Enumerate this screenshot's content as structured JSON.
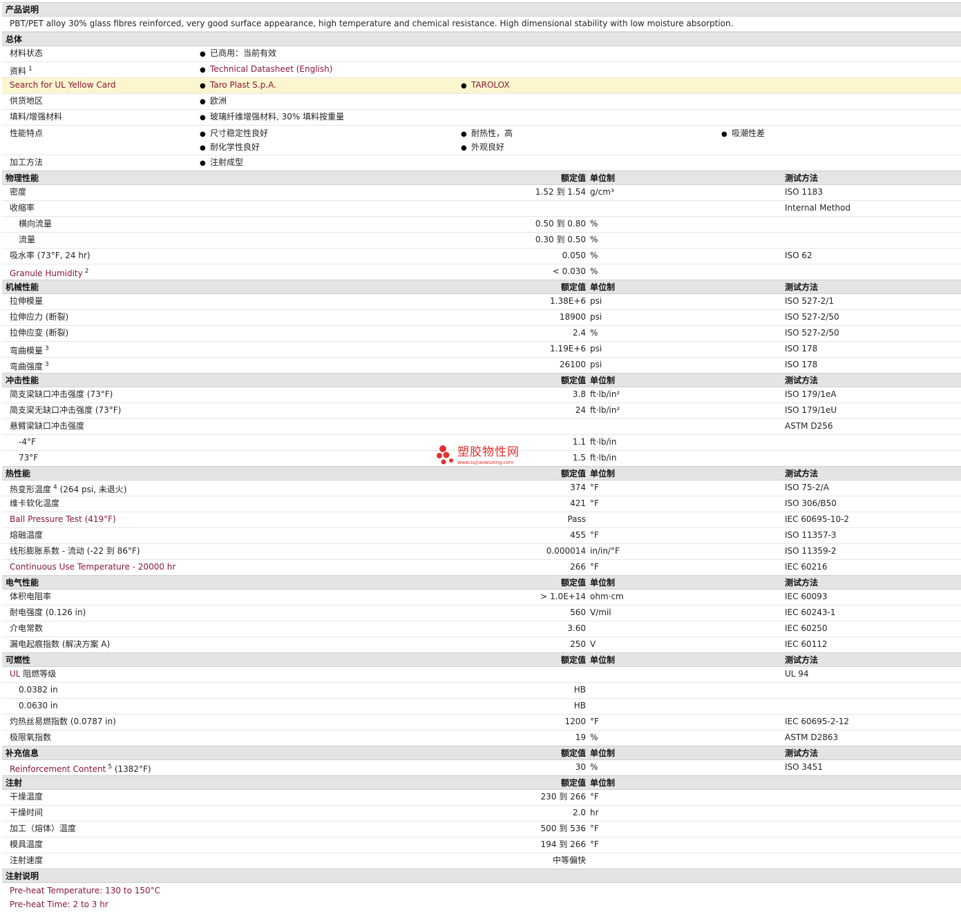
{
  "sections": {
    "product_desc": "产品说明",
    "general": "总体",
    "physical": "物理性能",
    "mechanical": "机械性能",
    "impact": "冲击性能",
    "thermal": "热性能",
    "electrical": "电气性能",
    "flammability": "可燃性",
    "additional": "补充信息",
    "injection": "注射",
    "injection_notes": "注射说明"
  },
  "col_headers": {
    "value": "额定值",
    "unit": "单位制",
    "test": "测试方法"
  },
  "description": "PBT/PET alloy 30% glass fibres reinforced, very good surface appearance, high temperature and chemical resistance. High dimensional stability with low moisture absorption.",
  "general": {
    "status_label": "材料状态",
    "status_value": "已商用：当前有效",
    "docs_label": "资料",
    "docs_sup": "1",
    "docs_link": "Technical Datasheet (English)",
    "ul_label": "Search for UL Yellow Card",
    "ul_link1": "Taro Plast S.p.A.",
    "ul_link2": "TAROLOX",
    "region_label": "供货地区",
    "region_value": "欧洲",
    "filler_label": "填料/增强材料",
    "filler_value": "玻璃纤维增强材料, 30% 填料按重量",
    "features_label": "性能特点",
    "features": [
      "尺寸稳定性良好",
      "耐热性，高",
      "吸潮性差",
      "耐化学性良好",
      "外观良好"
    ],
    "method_label": "加工方法",
    "method_value": "注射成型"
  },
  "physical": {
    "density": {
      "label": "密度",
      "value": "1.52 到  1.54",
      "unit": "g/cm³",
      "test": "ISO 1183"
    },
    "shrink": {
      "label": "收缩率",
      "test": "Internal Method"
    },
    "shrink_trans": {
      "label": "横向流量",
      "value": "0.50 到  0.80",
      "unit": "%"
    },
    "shrink_flow": {
      "label": "流量",
      "value": "0.30 到  0.50",
      "unit": "%"
    },
    "water": {
      "label": "吸水率  (73°F, 24 hr)",
      "value": "0.050",
      "unit": "%",
      "test": "ISO 62"
    },
    "granule": {
      "label": "Granule Humidity",
      "sup": "2",
      "value": "< 0.030",
      "unit": "%"
    }
  },
  "mechanical": {
    "tmod": {
      "label": "拉伸模量",
      "value": "1.38E+6",
      "unit": "psi",
      "test": "ISO 527-2/1"
    },
    "tstress": {
      "label": "拉伸应力  (断裂)",
      "value": "18900",
      "unit": "psi",
      "test": "ISO 527-2/50"
    },
    "tstrain": {
      "label": "拉伸应变  (断裂)",
      "value": "2.4",
      "unit": "%",
      "test": "ISO 527-2/50"
    },
    "fmod": {
      "label": "弯曲模量",
      "sup": "3",
      "value": "1.19E+6",
      "unit": "psi",
      "test": "ISO 178"
    },
    "fstr": {
      "label": "弯曲强度",
      "sup": "3",
      "value": "26100",
      "unit": "psi",
      "test": "ISO 178"
    }
  },
  "impact": {
    "charpy_n": {
      "label": "简支梁缺口冲击强度  (73°F)",
      "value": "3.8",
      "unit": "ft·lb/in²",
      "test": "ISO 179/1eA"
    },
    "charpy_u": {
      "label": "简支梁无缺口冲击强度  (73°F)",
      "value": "24",
      "unit": "ft·lb/in²",
      "test": "ISO 179/1eU"
    },
    "izod": {
      "label": "悬臂梁缺口冲击强度",
      "test": "ASTM D256"
    },
    "izod_m4": {
      "label": "-4°F",
      "value": "1.1",
      "unit": "ft·lb/in"
    },
    "izod_73": {
      "label": "73°F",
      "value": "1.5",
      "unit": "ft·lb/in"
    }
  },
  "thermal": {
    "hdt": {
      "label": "热变形温度",
      "sup": "4",
      "label2": "(264 psi, 未退火)",
      "value": "374",
      "unit": "°F",
      "test": "ISO 75-2/A"
    },
    "vicat": {
      "label": "维卡软化温度",
      "value": "421",
      "unit": "°F",
      "test": "ISO 306/B50"
    },
    "ball": {
      "label": "Ball Pressure Test  (419°F)",
      "value": "Pass",
      "test": "IEC 60695-10-2"
    },
    "melt": {
      "label": "熔融温度",
      "value": "455",
      "unit": "°F",
      "test": "ISO 11357-3"
    },
    "clte": {
      "label": "线形膨胀系数  - 流动  (-22 到  86°F)",
      "value": "0.000014",
      "unit": "in/in/°F",
      "test": "ISO 11359-2"
    },
    "cut": {
      "label": "Continuous Use Temperature - 20000 hr",
      "value": "266",
      "unit": "°F",
      "test": "IEC 60216"
    }
  },
  "electrical": {
    "vol": {
      "label": "体积电阻率",
      "value": "> 1.0E+14",
      "unit": "ohm·cm",
      "test": "IEC 60093"
    },
    "diel": {
      "label": "耐电强度  (0.126 in)",
      "value": "560",
      "unit": "V/mil",
      "test": "IEC 60243-1"
    },
    "const": {
      "label": "介电常数",
      "value": "3.60",
      "test": "IEC 60250"
    },
    "cti": {
      "label": "漏电起痕指数  (解决方案  A)",
      "value": "250",
      "unit": "V",
      "test": "IEC 60112"
    }
  },
  "flammability": {
    "ul": {
      "label_link": "UL",
      "label": " 阻燃等级",
      "test": "UL 94"
    },
    "ul_1": {
      "label": "0.0382 in",
      "value": "HB"
    },
    "ul_2": {
      "label": "0.0630 in",
      "value": "HB"
    },
    "gwfi": {
      "label": "灼热丝易燃指数  (0.0787 in)",
      "value": "1200",
      "unit": "°F",
      "test": "IEC 60695-2-12"
    },
    "loi": {
      "label": "极限氧指数",
      "value": "19",
      "unit": "%",
      "test": "ASTM D2863"
    }
  },
  "additional": {
    "reinf": {
      "label": "Reinforcement Content",
      "sup": "5",
      "label2": "(1382°F)",
      "value": "30",
      "unit": "%",
      "test": "ISO 3451"
    }
  },
  "injection": {
    "dry_temp": {
      "label": "干燥温度",
      "value": "230 到  266",
      "unit": "°F"
    },
    "dry_time": {
      "label": "干燥时间",
      "value": "2.0",
      "unit": "hr"
    },
    "melt_temp": {
      "label": "加工（熔体）温度",
      "value": "500 到  536",
      "unit": "°F"
    },
    "mold_temp": {
      "label": "模具温度",
      "value": "194 到  266",
      "unit": "°F"
    },
    "speed": {
      "label": "注射速度",
      "value": "中等偏快"
    }
  },
  "notes": [
    "Pre-heat Temperature: 130 to 150°C",
    "Pre-heat Time: 2 to 3 hr"
  ],
  "watermark": {
    "title": "塑胶物性网",
    "url": "www.sujiaowuxing.com",
    "color": "#e23030"
  }
}
